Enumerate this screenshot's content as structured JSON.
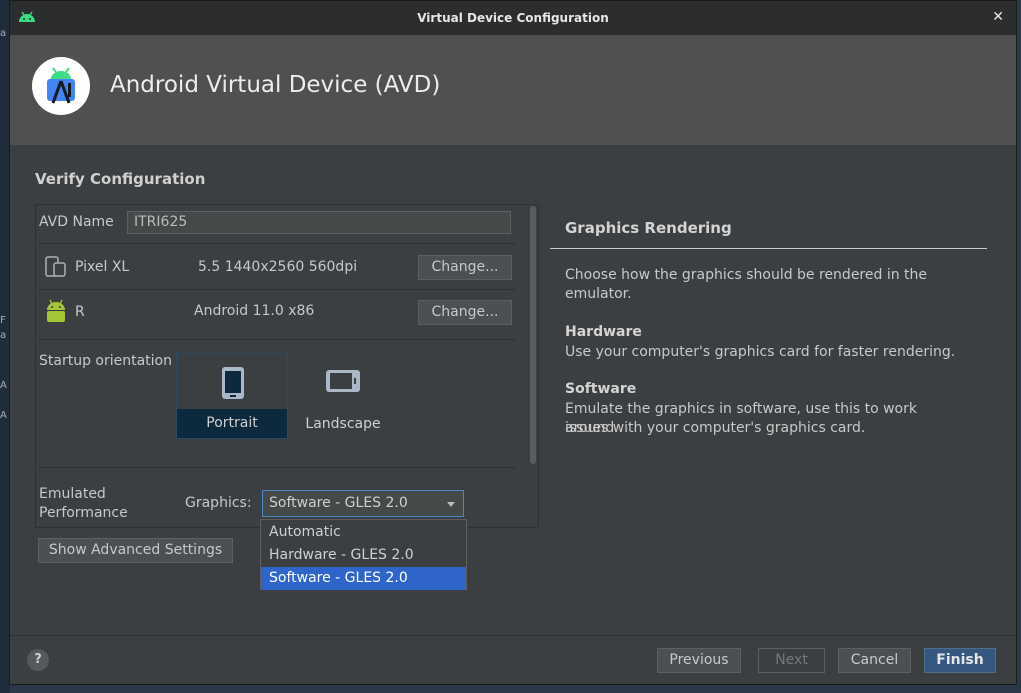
{
  "window": {
    "title": "Virtual Device Configuration",
    "close_glyph": "✕"
  },
  "header": {
    "title": "Android Virtual Device (AVD)",
    "logo_icon": "android-studio-logo"
  },
  "section": {
    "title": "Verify Configuration"
  },
  "avd_name": {
    "label": "AVD Name",
    "value": "ITRI625"
  },
  "device": {
    "name": "Pixel XL",
    "spec": "5.5 1440x2560 560dpi",
    "change_label": "Change..."
  },
  "system_image": {
    "name": "R",
    "spec": "Android 11.0 x86",
    "change_label": "Change..."
  },
  "orientation": {
    "label": "Startup orientation",
    "options": [
      "Portrait",
      "Landscape"
    ],
    "selected": "Portrait"
  },
  "performance": {
    "label_line1": "Emulated",
    "label_line2": "Performance",
    "graphics_label": "Graphics:",
    "graphics_value": "Software - GLES 2.0",
    "options": [
      "Automatic",
      "Hardware - GLES 2.0",
      "Software - GLES 2.0"
    ],
    "selected_index": 2
  },
  "advanced_button": "Show Advanced Settings",
  "help": {
    "title": "Graphics Rendering",
    "intro_line1": "Choose how the graphics should be rendered in the",
    "intro_line2": "emulator.",
    "hardware_title": "Hardware",
    "hardware_text": "Use your computer's graphics card for faster rendering.",
    "software_title": "Software",
    "software_line1": "Emulate the graphics in software, use this to work around",
    "software_line2": "issues with your computer's graphics card."
  },
  "footer": {
    "help_glyph": "?",
    "previous": "Previous",
    "next": "Next",
    "cancel": "Cancel",
    "finish": "Finish"
  },
  "background_strip": [
    "a",
    "F",
    "a",
    "A",
    "A"
  ],
  "colors": {
    "accent": "#2f65ca",
    "primary_button": "#365880",
    "android_green": "#3ddc84"
  }
}
